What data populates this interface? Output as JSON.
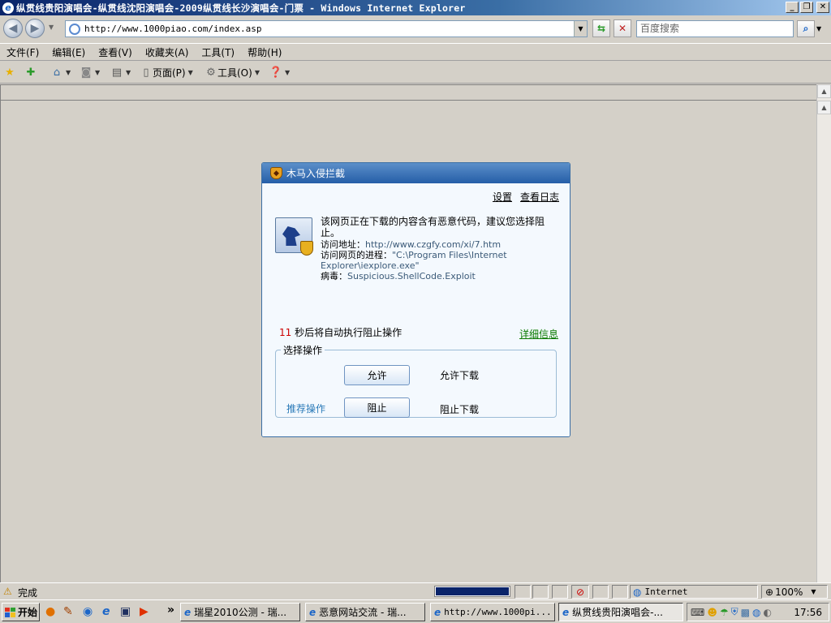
{
  "window": {
    "title": "纵贯线贵阳演唱会-纵贯线沈阳演唱会-2009纵贯线长沙演唱会-门票 - Windows Internet Explorer",
    "minimize": "_",
    "restore": "❐",
    "close": "✕"
  },
  "address": {
    "url": "http://www.1000piao.com/index.asp"
  },
  "search": {
    "placeholder": "百度搜索"
  },
  "menu": {
    "items": [
      "文件(F)",
      "编辑(E)",
      "查看(V)",
      "收藏夹(A)",
      "工具(T)",
      "帮助(H)"
    ]
  },
  "commandbar": {
    "page_label": "页面(P)",
    "tools_label": "工具(O)"
  },
  "dialog": {
    "title": "木马入侵拦截",
    "settings_link": "设置",
    "log_link": "查看日志",
    "message": "该网页正在下载的内容含有恶意代码，建议您选择阻止。",
    "url_label": "访问地址：",
    "url_value": "http://www.czgfy.com/xi/7.htm",
    "process_label": "访问网页的进程：",
    "process_value": "\"C:\\Program Files\\Internet Explorer\\iexplore.exe\"",
    "virus_label": "病毒：",
    "virus_value": "Suspicious.ShellCode.Exploit",
    "countdown_seconds": "11",
    "countdown_text": " 秒后将自动执行阻止操作",
    "detail_link": "详细信息",
    "choice_legend": "选择操作",
    "allow_button": "允许",
    "allow_desc": "允许下载",
    "recommend_label": "推荐操作",
    "block_button": "阻止",
    "block_desc": "阻止下载"
  },
  "statusbar": {
    "status_text": "完成",
    "zone": "Internet",
    "zoom": "100%",
    "progress_fraction": 1.0
  },
  "taskbar": {
    "start": "开始",
    "overflow": "»",
    "items": [
      "瑞星2010公测 - 瑞...",
      "恶意网站交流 - 瑞...",
      "http://www.1000pi...",
      "纵贯线贵阳演唱会-..."
    ],
    "clock": "17:56"
  },
  "colors": {
    "title_bar": "#0a246a",
    "dialog_header": "#255ea8",
    "countdown_number": "#cc0000",
    "detail_link": "#0a7a00",
    "recommend": "#2a7ab8"
  }
}
